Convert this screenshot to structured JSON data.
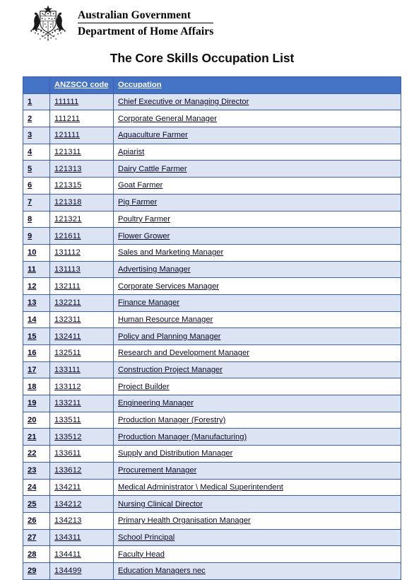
{
  "masthead": {
    "crest_icon": "australian-coat-of-arms",
    "line1": "Australian Government",
    "line2": "Department of Home Affairs"
  },
  "page_title": "The Core Skills Occupation List",
  "colors": {
    "header_blue": "#4472c4",
    "border_blue": "#3a5fae",
    "row_shade": "#dce3f2",
    "text": "#0a0a28"
  },
  "table": {
    "columns": [
      "",
      "ANZSCO code",
      "Occupation"
    ],
    "rows": [
      {
        "no": "1",
        "code": "111111",
        "occupation": "Chief Executive or Managing Director"
      },
      {
        "no": "2",
        "code": "111211",
        "occupation": "Corporate General Manager"
      },
      {
        "no": "3",
        "code": "121111",
        "occupation": "Aquaculture Farmer"
      },
      {
        "no": "4",
        "code": "121311",
        "occupation": "Apiarist"
      },
      {
        "no": "5",
        "code": "121313",
        "occupation": "Dairy Cattle Farmer"
      },
      {
        "no": "6",
        "code": "121315",
        "occupation": "Goat Farmer"
      },
      {
        "no": "7",
        "code": "121318",
        "occupation": "Pig Farmer"
      },
      {
        "no": "8",
        "code": "121321",
        "occupation": "Poultry Farmer"
      },
      {
        "no": "9",
        "code": "121611",
        "occupation": "Flower Grower"
      },
      {
        "no": "10",
        "code": "131112",
        "occupation": "Sales and Marketing Manager"
      },
      {
        "no": "11",
        "code": "131113",
        "occupation": "Advertising Manager"
      },
      {
        "no": "12",
        "code": "132111",
        "occupation": "Corporate Services Manager"
      },
      {
        "no": "13",
        "code": "132211",
        "occupation": "Finance Manager"
      },
      {
        "no": "14",
        "code": "132311",
        "occupation": "Human Resource Manager"
      },
      {
        "no": "15",
        "code": "132411",
        "occupation": "Policy and Planning Manager"
      },
      {
        "no": "16",
        "code": "132511",
        "occupation": "Research and Development Manager"
      },
      {
        "no": "17",
        "code": "133111",
        "occupation": "Construction Project Manager"
      },
      {
        "no": "18",
        "code": "133112",
        "occupation": "Project Builder"
      },
      {
        "no": "19",
        "code": "133211",
        "occupation": "Engineering Manager"
      },
      {
        "no": "20",
        "code": "133511",
        "occupation": "Production Manager (Forestry)"
      },
      {
        "no": "21",
        "code": "133512",
        "occupation": "Production Manager (Manufacturing)"
      },
      {
        "no": "22",
        "code": "133611",
        "occupation": "Supply and Distribution Manager"
      },
      {
        "no": "23",
        "code": "133612",
        "occupation": "Procurement Manager"
      },
      {
        "no": "24",
        "code": "134211",
        "occupation": "Medical Administrator \\ Medical Superintendent"
      },
      {
        "no": "25",
        "code": "134212",
        "occupation": "Nursing Clinical Director"
      },
      {
        "no": "26",
        "code": "134213",
        "occupation": "Primary Health Organisation Manager"
      },
      {
        "no": "27",
        "code": "134311",
        "occupation": "School Principal"
      },
      {
        "no": "28",
        "code": "134411",
        "occupation": "Faculty Head"
      },
      {
        "no": "29",
        "code": "134499",
        "occupation": "Education Managers nec"
      }
    ]
  }
}
